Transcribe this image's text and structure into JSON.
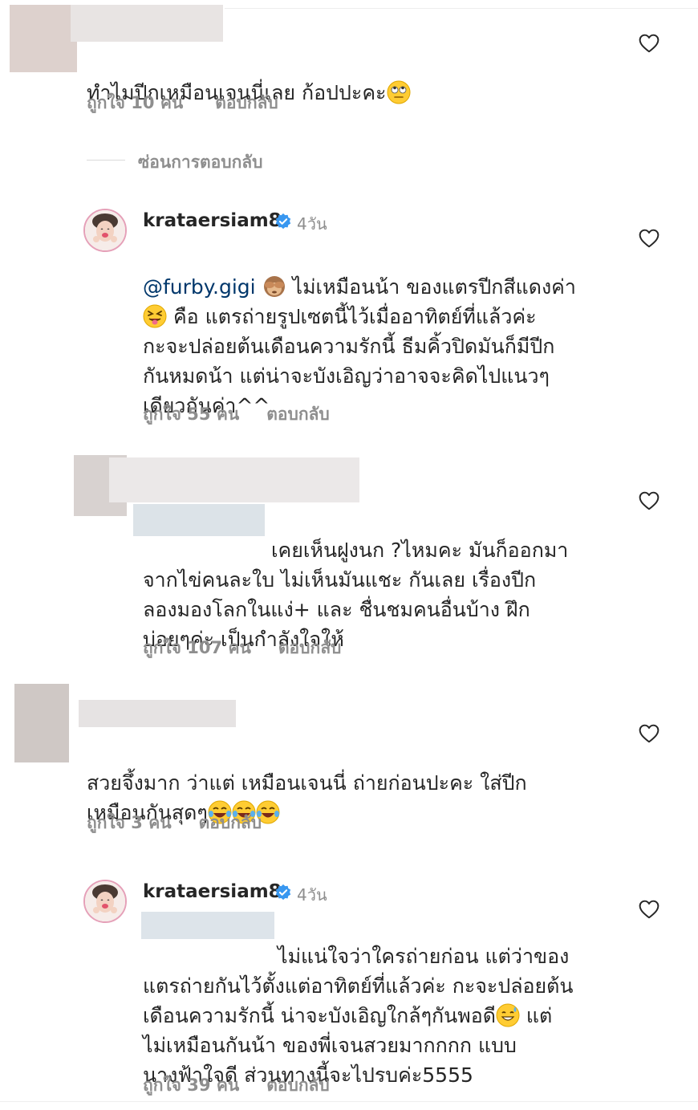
{
  "comments": [
    {
      "text": "ทำไมปีกเหมือนเจนนี่เลย ก้อปปะคะ",
      "likes": "ถูกใจ 10 คน",
      "reply": "ตอบกลับ"
    },
    {
      "username": "krataersiam8",
      "time": "4วัน",
      "mention": "@furby.gigi",
      "text_after_mention": " ไม่เหมือนน้า ของแตรปีกสีแดงค่า",
      "text_line2": " คือ แตรถ่ายรูปเซตนี้ไว้เมื่ออาทิตย์ที่แล้วค่ะ",
      "text_rest": "กะจะปล่อยต้นเดือนความรักนี้ ธีมคิ้วปิดมันก็มีปีก\nกันหมดน้า แต่น่าจะบังเอิญว่าอาจจะคิดไปแนวๆ\nเดียวกันค่า^^",
      "likes": "ถูกใจ 55 คน",
      "reply": "ตอบกลับ"
    },
    {
      "text_first": "เคยเห็นฝูงนก ?ไหมคะ  มันก็ออกมา",
      "text_rest": "จากไข่คนละใบ ไม่เห็นมันแชะ กันเลย เรื่องปีก\nลองมองโลกในแง่+ และ ชื่นชมคนอื่นบ้าง  ฝึก\nบ่อยๆค่ะ เป็นกำลังใจให้",
      "likes": "ถูกใจ 107 คน",
      "reply": "ตอบกลับ"
    },
    {
      "text_line1": "สวยจึ้งมาก ว่าแต่ เหมือนเจนนี่ ถ่ายก่อนปะคะ  ใส่ปีก",
      "text_line2": "เหมือนกันสุดๆ",
      "likes": "ถูกใจ 3 คน",
      "reply": "ตอบกลับ"
    },
    {
      "username": "krataersiam8",
      "time": "4วัน",
      "text_first": "ไม่แน่ใจว่าใครถ่ายก่อน แต่ว่าของ",
      "text_line2": "แตรถ่ายกันไว้ตั้งแต่อาทิตย์ที่แล้วค่ะ กะจะปล่อยต้น",
      "text_line3": "เดือนความรักนี้ น่าจะบังเอิญใกล้ๆกันพอดี",
      "text_line3_after": " แต่",
      "text_rest": "ไม่เหมือนกันน้า ของพี่เจนสวยมากกกก แบบ\nนางฟ้าใจดี ส่วนทางนี้จะไปรบค่ะ5555",
      "likes": "ถูกใจ 39 คน",
      "reply": "ตอบกลับ"
    }
  ],
  "hide_replies": "ซ่อนการตอบกลับ",
  "icons": {
    "heart": "heart-icon",
    "verified": "verified-badge-icon",
    "eye_roll": "face-eye-roll-icon",
    "monkey": "see-no-evil-monkey-icon",
    "squint_tongue": "squinting-tongue-face-icon",
    "laugh_tears": "face-tears-of-joy-icon",
    "sweat_grin": "grinning-sweat-face-icon"
  },
  "colors": {
    "text": "#262626",
    "secondary": "#8e8e8e",
    "link": "#00376b",
    "verified": "#3897f0"
  }
}
